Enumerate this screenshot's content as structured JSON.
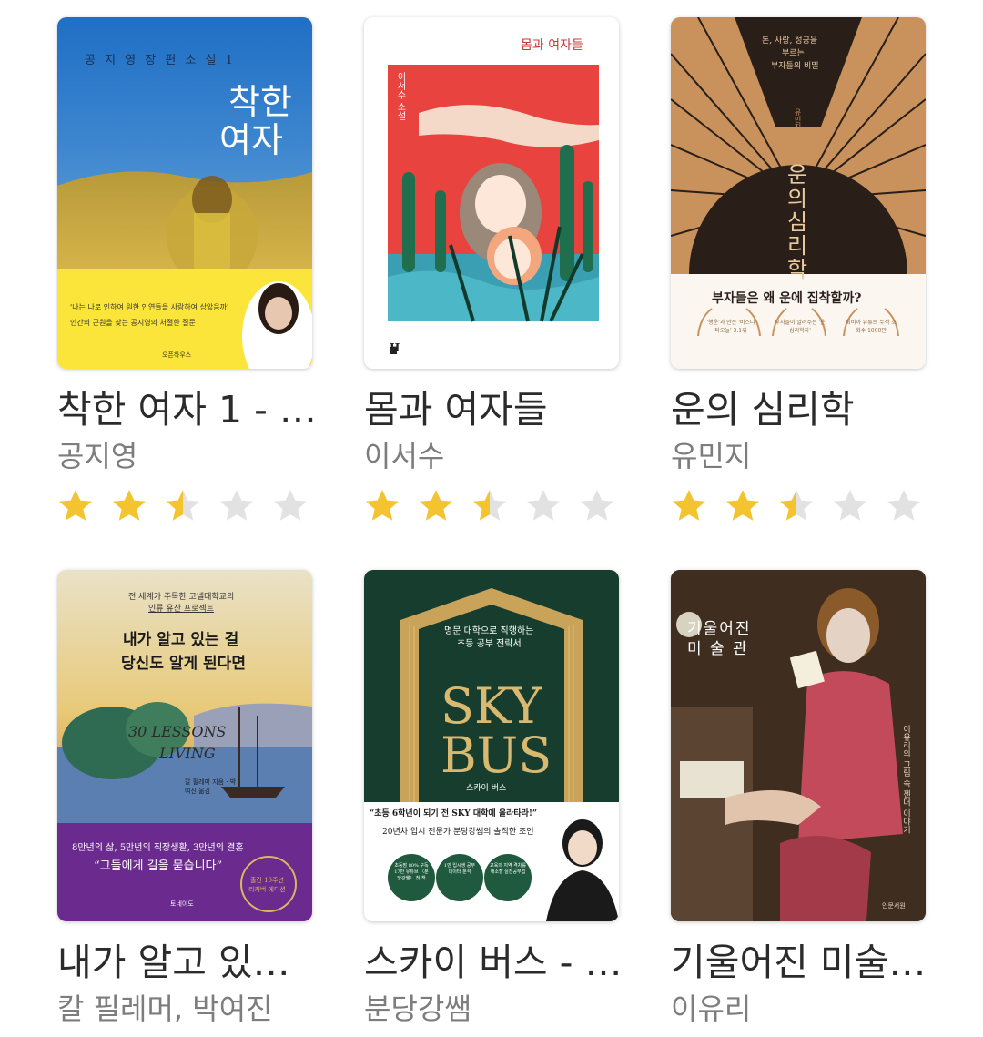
{
  "colors": {
    "title": "#2b2b2b",
    "author": "#7d7d7d",
    "star_on": "#f4c430",
    "star_off": "#e2e2e2"
  },
  "books": [
    {
      "title": "착한 여자 1 - …",
      "author": "공지영",
      "rating": 2.5,
      "cover": {
        "series": "공 지 영 장 편 소 설 1",
        "title_line1": "착한",
        "title_line2": "여자",
        "quote": "'나는 나로 인하여 원한 인연들을 사랑하여 상앓음까'",
        "tagline": "인간의 근원을 찾는 공지영의 처절한 질문",
        "publisher": "오픈하우스"
      }
    },
    {
      "title": "몸과 여자들",
      "author": "이서수",
      "rating": 2.5,
      "cover": {
        "top_title": "몸과 여자들",
        "vertical": "이서수 소설",
        "publisher_mark": "H"
      }
    },
    {
      "title": "운의 심리학",
      "author": "유민지",
      "rating": 2.5,
      "cover": {
        "top1": "돈, 사랑, 성공을",
        "top2": "부르는",
        "top3": "부자들의 비밀",
        "author_mark": "유민지 지음",
        "title_chars": [
          "운",
          "의",
          "심",
          "리",
          "학"
        ],
        "question": "부자들은 왜 운에 집착할까?",
        "badges": [
          "'행운'과 만든 '비스니타오늘' 3.1위",
          "부자들이 알려주는 '운 심리학자'",
          "회비까 유튜브 누적 조회수 1000만"
        ]
      }
    },
    {
      "title": "내가 알고 있…",
      "author": "칼 필레머, 박여진",
      "cover": {
        "line1": "전 세계가 주목한 코넬대학교의",
        "line2": "인류 유산 프로젝트",
        "title1": "내가 알고 있는 걸",
        "title2": "당신도 알게 된다면",
        "eng1": "30 LESSONS",
        "eng2": "LIVING",
        "translator": "칼 필레머 지음 · 박여진 옮김",
        "bottom1": "8만년의 삶, 5만년의 직장생활, 3만년의 결혼",
        "bottom2": "“그들에게 길을 묻습니다”",
        "award1": "출간 10주년",
        "award2": "리커버 에디션",
        "publisher": "토네이도"
      }
    },
    {
      "title": "스카이 버스 - …",
      "author": "분당강쌤",
      "cover": {
        "sub1": "명문 대학으로 직행하는",
        "sub2": "초등 공부 전략서",
        "big1": "SKY",
        "big2": "BUS",
        "small": "스카이 버스",
        "quote": "“초등 6학년이 되기 전 SKY 대학에 올라타라!”",
        "line": "20년차 입시 전문가 분당강쌤의 솔직한 조언",
        "circles": [
          "초등맘 80% 구독 17만 유튜브 〈분당강쌤〉 첫 책",
          "1만 입시생 공부 데이터 분석",
          "교육의 지역 격차를 해소할 실전공부법"
        ]
      }
    },
    {
      "title": "기울어진 미술…",
      "author": "이유리",
      "cover": {
        "title1": "기울어진",
        "title2": "미 술 관",
        "vertical": "이유리의 그림 속 젠더 이야기",
        "publisher": "인문서원"
      }
    }
  ]
}
